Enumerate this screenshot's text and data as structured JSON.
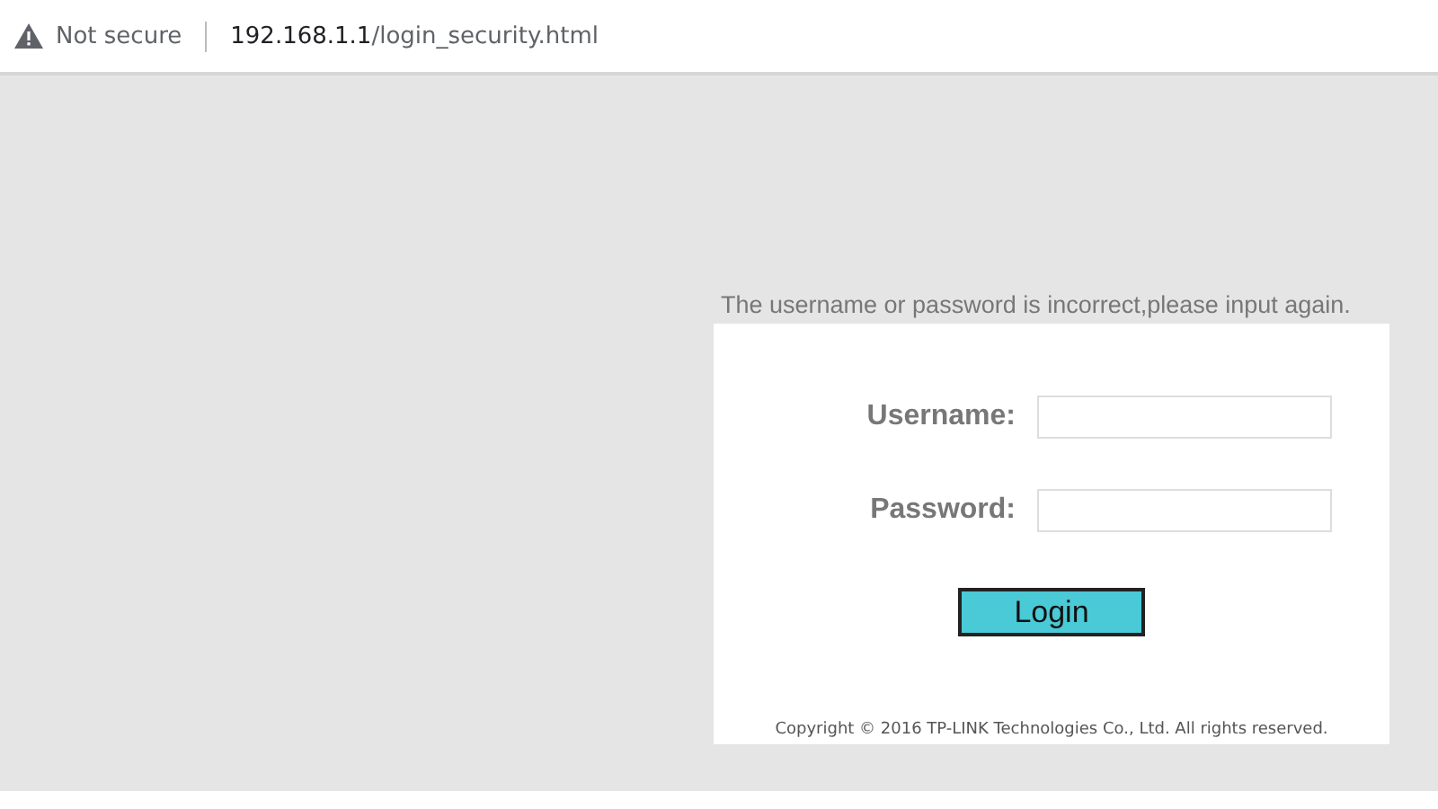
{
  "address_bar": {
    "security": "Not secure",
    "url_host": "192.168.1.1",
    "url_path": "/login_security.html"
  },
  "login": {
    "error_message": "The username or password is incorrect,please input again.",
    "fields": [
      {
        "label": "Username:"
      },
      {
        "label": "Password:"
      }
    ],
    "button": "Login",
    "copyright": "Copyright © 2016 TP-LINK Technologies Co., Ltd. All rights reserved."
  }
}
